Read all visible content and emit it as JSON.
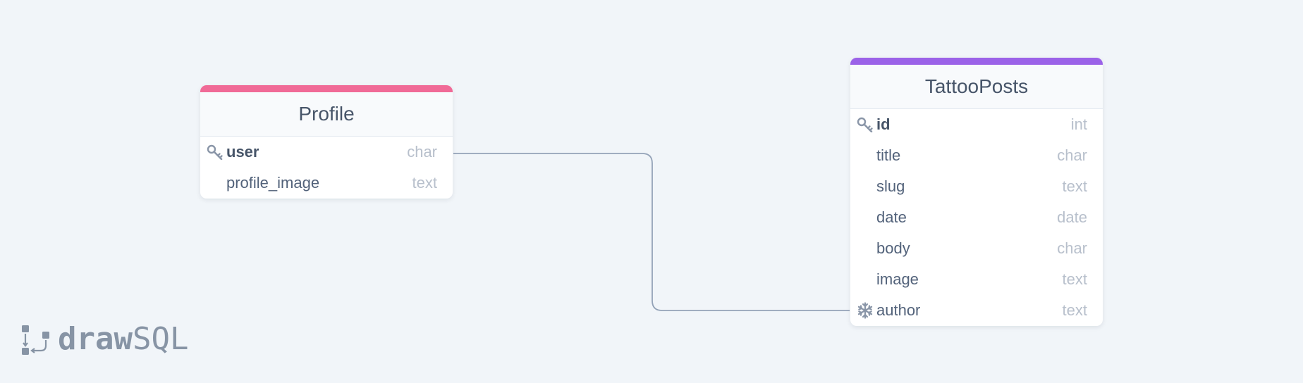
{
  "diagram": {
    "tables": [
      {
        "name": "Profile",
        "accent_color": "#f06a97",
        "columns": [
          {
            "name": "user",
            "type": "char",
            "icon": "key-icon",
            "primary": true
          },
          {
            "name": "profile_image",
            "type": "text",
            "icon": "",
            "primary": false
          }
        ]
      },
      {
        "name": "TattooPosts",
        "accent_color": "#9b62e8",
        "columns": [
          {
            "name": "id",
            "type": "int",
            "icon": "key-icon",
            "primary": true
          },
          {
            "name": "title",
            "type": "char",
            "icon": "",
            "primary": false
          },
          {
            "name": "slug",
            "type": "text",
            "icon": "",
            "primary": false
          },
          {
            "name": "date",
            "type": "date",
            "icon": "",
            "primary": false
          },
          {
            "name": "body",
            "type": "char",
            "icon": "",
            "primary": false
          },
          {
            "name": "image",
            "type": "text",
            "icon": "",
            "primary": false
          },
          {
            "name": "author",
            "type": "text",
            "icon": "snowflake-icon",
            "primary": false
          }
        ]
      }
    ],
    "relations": [
      {
        "from_table": "Profile",
        "from_column": "user",
        "to_table": "TattooPosts",
        "to_column": "author",
        "line_color": "#94a3b8"
      }
    ]
  },
  "branding": {
    "logo_bold": "draw",
    "logo_light": "SQL",
    "logo_color": "#8794a5"
  }
}
